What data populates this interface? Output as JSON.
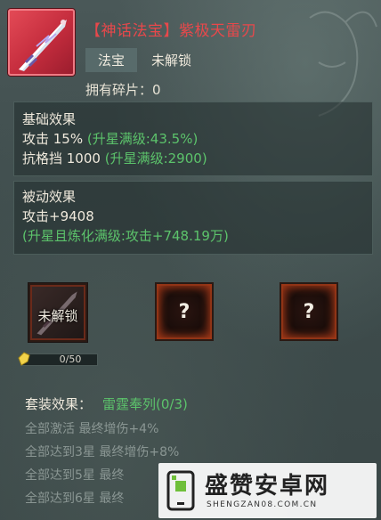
{
  "item": {
    "title": "【神话法宝】紫极天雷刃",
    "type": "法宝",
    "status": "未解锁",
    "fragments": "拥有碎片：0"
  },
  "basic": {
    "heading": "基础效果",
    "attack": "攻击 15%",
    "attack_max": "(升星满级:43.5%)",
    "block": "抗格挡 1000",
    "block_max": "(升星满级:2900)"
  },
  "passive": {
    "heading": "被动效果",
    "value": "攻击+9408",
    "max": "(升星且炼化满级:攻击+748.19万)"
  },
  "slots": {
    "locked_label": "未解锁",
    "unknown1": "?",
    "unknown2": "?",
    "progress_text": "0/50",
    "progress_fraction": 0
  },
  "set": {
    "label": "套装效果：",
    "name": "雷霆奉列(0/3)",
    "lines": [
      "全部激活 最终增伤+4%",
      "全部达到3星 最终增伤+8%",
      "全部达到5星 最终",
      "全部达到6星 最终"
    ]
  },
  "watermark": {
    "text": "盛赞安卓网",
    "url": "SHENGZAN08.COM.CN"
  },
  "colors": {
    "title_red": "#e8484b",
    "effect_green": "#5cc36b",
    "icon_red": "#d8394a"
  }
}
